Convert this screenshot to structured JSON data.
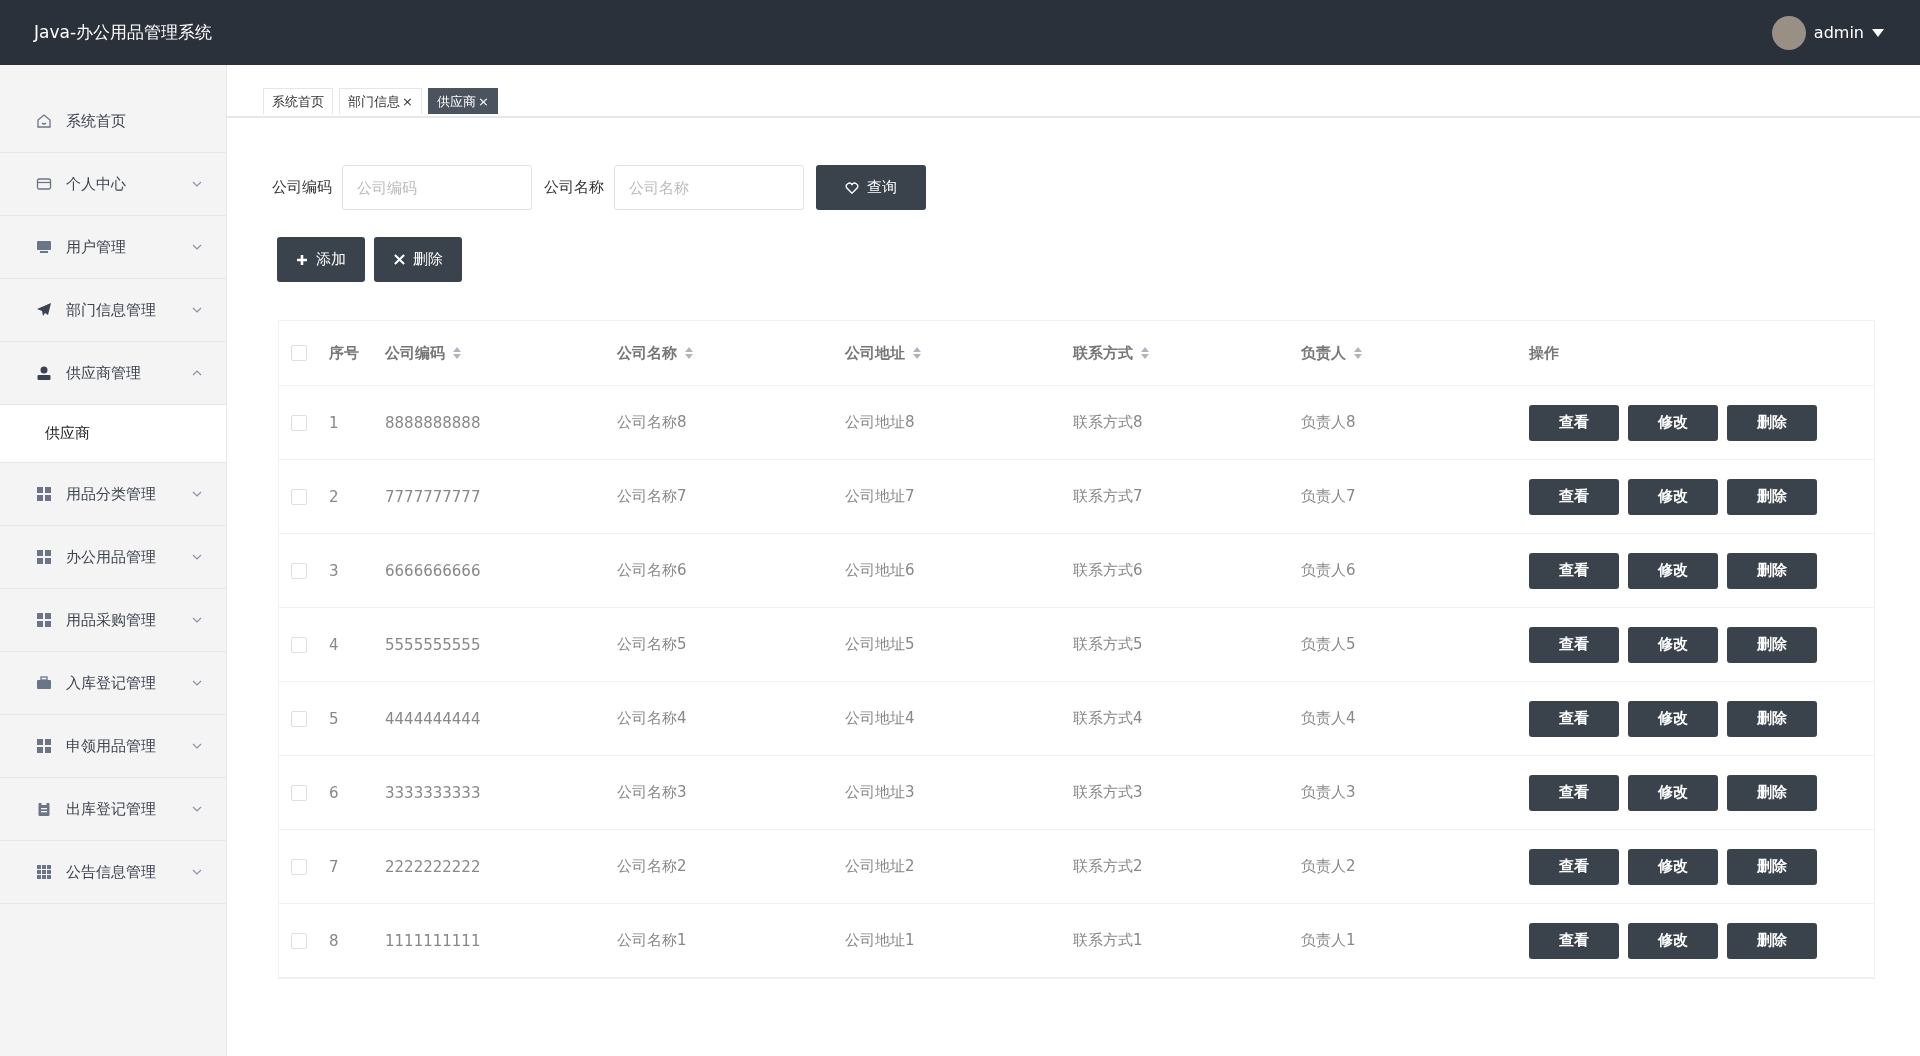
{
  "header": {
    "title": "Java-办公用品管理系统",
    "user": "admin"
  },
  "sidebar": {
    "items": [
      {
        "label": "系统首页"
      },
      {
        "label": "个人中心",
        "expanded": false
      },
      {
        "label": "用户管理",
        "expanded": false
      },
      {
        "label": "部门信息管理",
        "expanded": false
      },
      {
        "label": "供应商管理",
        "expanded": true,
        "children": [
          {
            "label": "供应商",
            "selected": true
          }
        ]
      },
      {
        "label": "用品分类管理",
        "expanded": false
      },
      {
        "label": "办公用品管理",
        "expanded": false
      },
      {
        "label": "用品采购管理",
        "expanded": false
      },
      {
        "label": "入库登记管理",
        "expanded": false
      },
      {
        "label": "申领用品管理",
        "expanded": false
      },
      {
        "label": "出库登记管理",
        "expanded": false
      },
      {
        "label": "公告信息管理",
        "expanded": false
      }
    ]
  },
  "tabs": [
    {
      "label": "系统首页",
      "selected": false
    },
    {
      "label": "部门信息",
      "close": "×",
      "selected": false
    },
    {
      "label": "供应商",
      "close": "×",
      "selected": true
    }
  ],
  "search": {
    "fields": [
      {
        "label": "公司编码",
        "placeholder": "公司编码"
      },
      {
        "label": "公司名称",
        "placeholder": "公司名称"
      }
    ],
    "button": "查询"
  },
  "actions": [
    {
      "label": "添加",
      "kind": "add"
    },
    {
      "label": "删除",
      "kind": "delete"
    }
  ],
  "table": {
    "all_checked": false,
    "columns": [
      {
        "label": "序号"
      },
      {
        "label": "公司编码"
      },
      {
        "label": "公司名称"
      },
      {
        "label": "公司地址"
      },
      {
        "label": "联系方式"
      },
      {
        "label": "负责人"
      },
      {
        "label": "操作"
      }
    ],
    "rows": [
      {
        "checked": false,
        "cells": [
          "1",
          "8888888888",
          "公司名称8",
          "公司地址8",
          "联系方式8",
          "负责人8"
        ],
        "actions": [
          "查看",
          "修改",
          "删除"
        ]
      },
      {
        "checked": false,
        "cells": [
          "2",
          "7777777777",
          "公司名称7",
          "公司地址7",
          "联系方式7",
          "负责人7"
        ],
        "actions": [
          "查看",
          "修改",
          "删除"
        ]
      },
      {
        "checked": false,
        "cells": [
          "3",
          "6666666666",
          "公司名称6",
          "公司地址6",
          "联系方式6",
          "负责人6"
        ],
        "actions": [
          "查看",
          "修改",
          "删除"
        ]
      },
      {
        "checked": false,
        "cells": [
          "4",
          "5555555555",
          "公司名称5",
          "公司地址5",
          "联系方式5",
          "负责人5"
        ],
        "actions": [
          "查看",
          "修改",
          "删除"
        ]
      },
      {
        "checked": false,
        "cells": [
          "5",
          "4444444444",
          "公司名称4",
          "公司地址4",
          "联系方式4",
          "负责人4"
        ],
        "actions": [
          "查看",
          "修改",
          "删除"
        ]
      },
      {
        "checked": false,
        "cells": [
          "6",
          "3333333333",
          "公司名称3",
          "公司地址3",
          "联系方式3",
          "负责人3"
        ],
        "actions": [
          "查看",
          "修改",
          "删除"
        ]
      },
      {
        "checked": false,
        "cells": [
          "7",
          "2222222222",
          "公司名称2",
          "公司地址2",
          "联系方式2",
          "负责人2"
        ],
        "actions": [
          "查看",
          "修改",
          "删除"
        ]
      },
      {
        "checked": false,
        "cells": [
          "8",
          "1111111111",
          "公司名称1",
          "公司地址1",
          "联系方式1",
          "负责人1"
        ],
        "actions": [
          "查看",
          "修改",
          "删除"
        ]
      }
    ]
  }
}
